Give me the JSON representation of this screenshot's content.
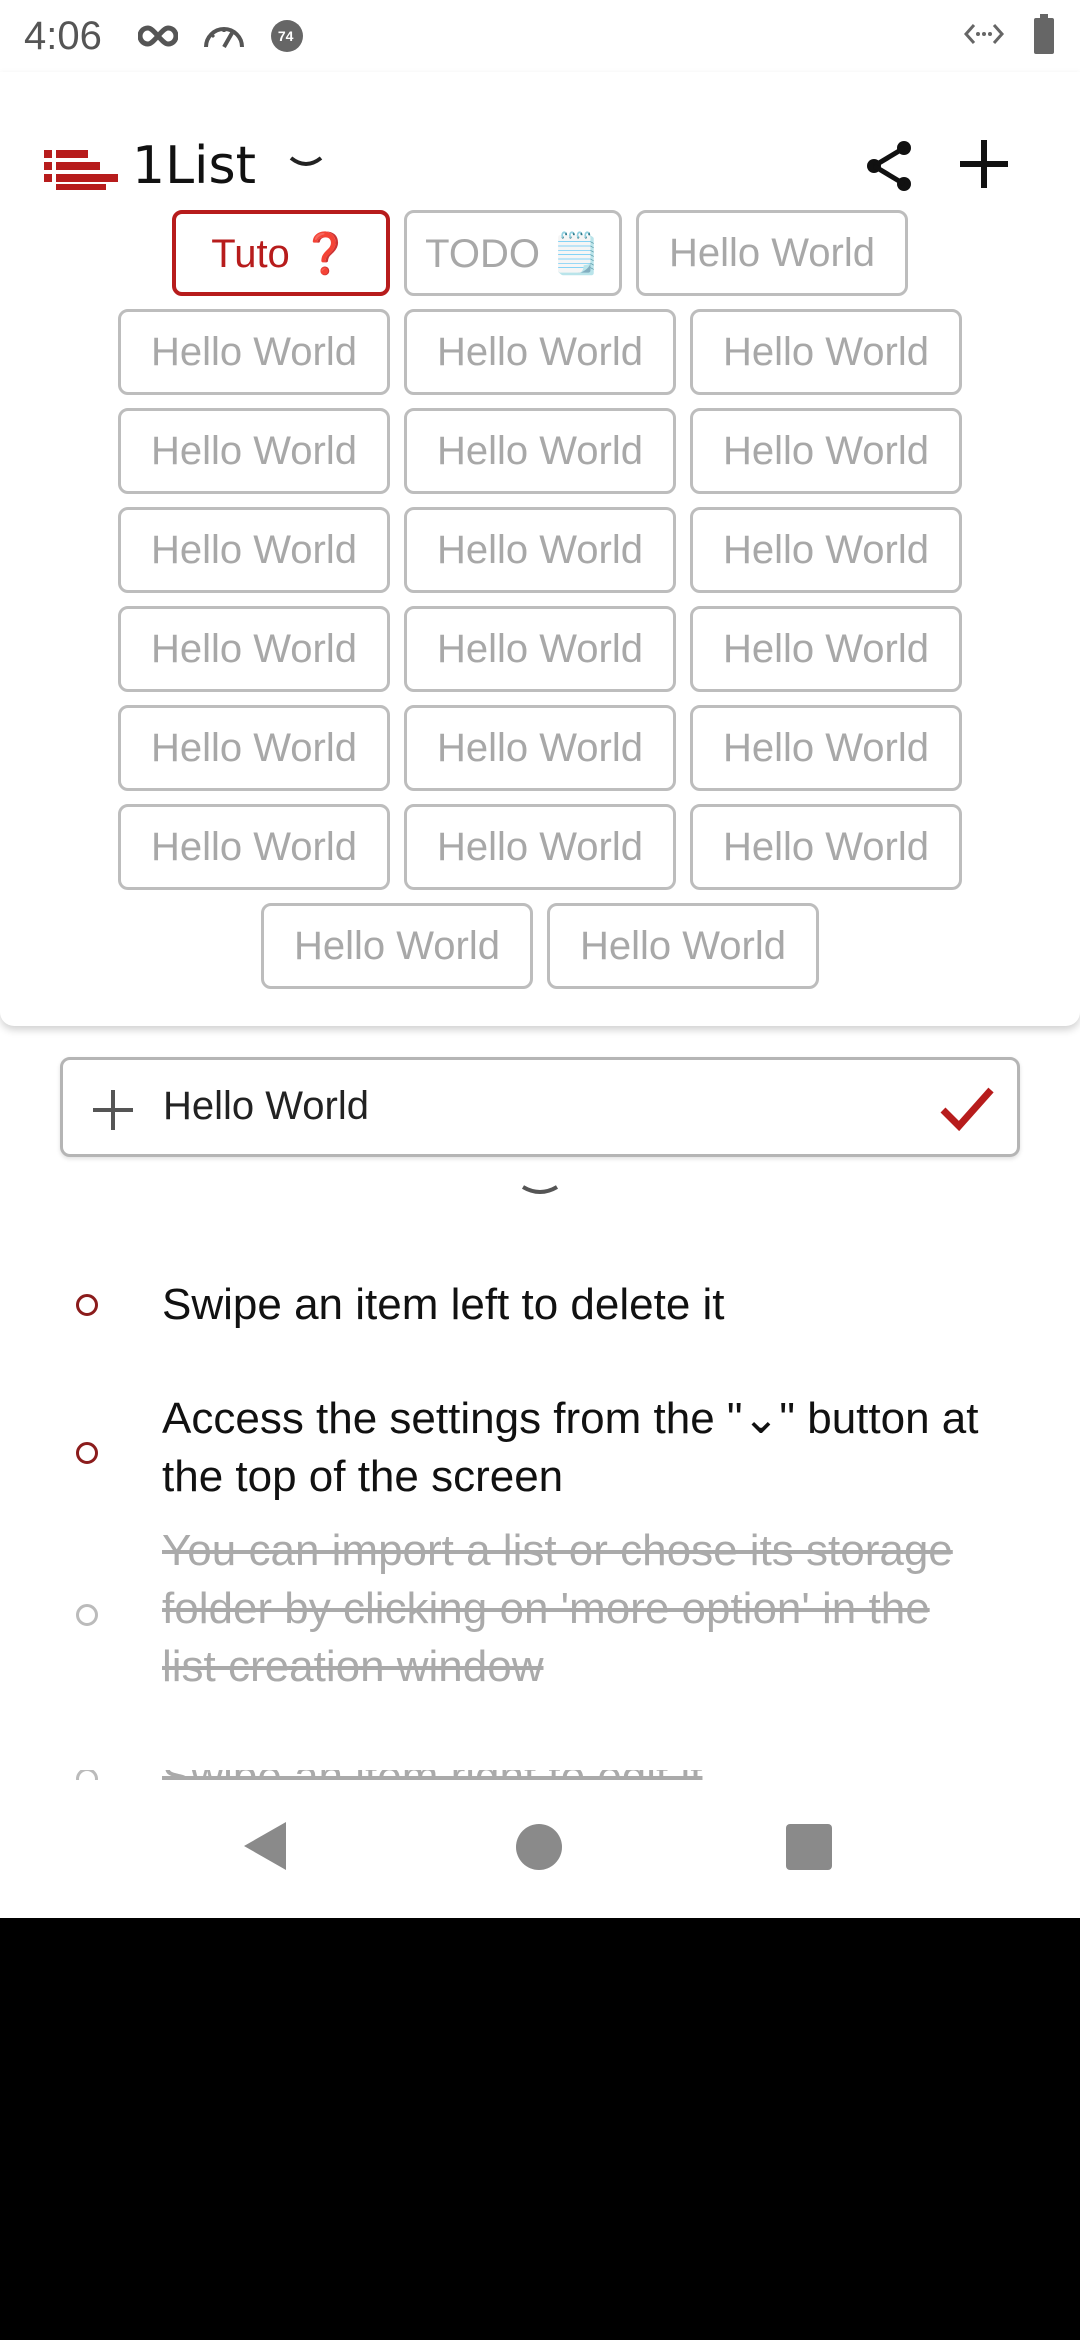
{
  "status_bar": {
    "time": "4:06",
    "icons": [
      "infinity-icon",
      "speedometer-icon",
      "notification-badge-icon"
    ],
    "badge_text": "74",
    "right_icons": [
      "data-sync-icon",
      "battery-icon"
    ]
  },
  "header": {
    "title": "1List",
    "logo_color": "#b71c1c"
  },
  "chips": {
    "row1": [
      "Tuto ❓",
      "TODO 🗒️",
      "Hello World"
    ],
    "rows": [
      [
        "Hello World",
        "Hello World",
        "Hello World"
      ],
      [
        "Hello World",
        "Hello World",
        "Hello World"
      ],
      [
        "Hello World",
        "Hello World",
        "Hello World"
      ],
      [
        "Hello World",
        "Hello World",
        "Hello World"
      ],
      [
        "Hello World",
        "Hello World",
        "Hello World"
      ],
      [
        "Hello World",
        "Hello World",
        "Hello World"
      ]
    ],
    "last_row": [
      "Hello World",
      "Hello World"
    ],
    "active": "Tuto ❓"
  },
  "input": {
    "value": "Hello World",
    "accent": "#b71c1c"
  },
  "items": [
    {
      "text": "Swipe an item left to delete it",
      "done": false
    },
    {
      "text": "Access the settings from the \"⌄\" button at the top of the screen",
      "done": false
    },
    {
      "text": "You can import a list or chose its storage folder by clicking on 'more option' in the list creation window",
      "done": true
    },
    {
      "text": "Swipe an item right to edit it",
      "done": true
    }
  ]
}
